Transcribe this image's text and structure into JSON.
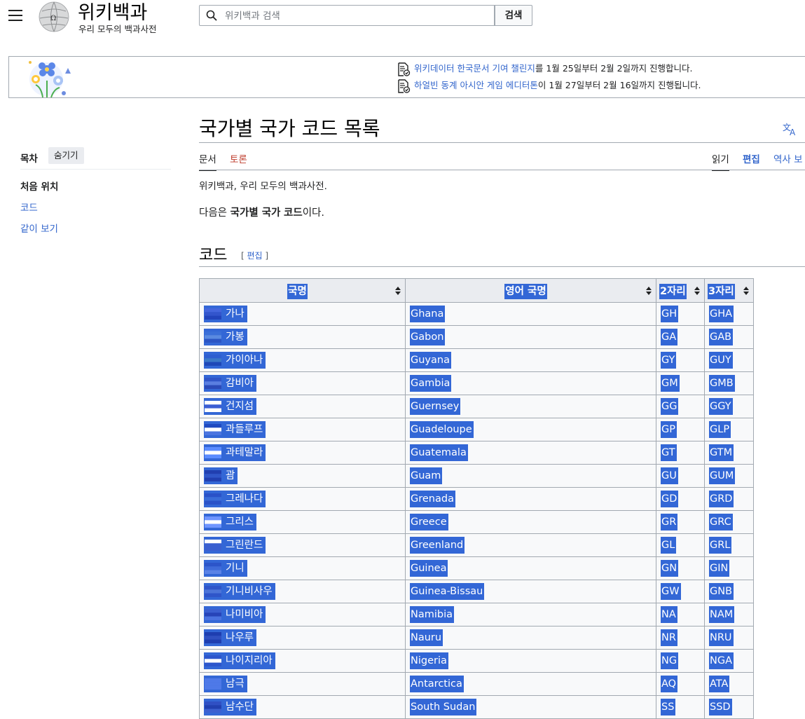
{
  "header": {
    "site_title": "위키백과",
    "site_tagline": "우리 모두의 백과사전",
    "search_placeholder": "위키백과 검색",
    "search_button": "검색"
  },
  "banner": {
    "notice_1": {
      "link": "위키데이터 한국문서 기여 챌린지",
      "text": "를 1월 25일부터 2월 2일까지 진행합니다."
    },
    "notice_2": {
      "link": "하얼빈 동계 아시안 게임 에디터톤",
      "text": "이 1월 27일부터 2월 16일까지 진행됩니다."
    }
  },
  "toc": {
    "title": "목차",
    "hide_label": "숨기기",
    "items": [
      "처음 위치",
      "코드",
      "같이 보기"
    ]
  },
  "page": {
    "title": "국가별 국가 코드 목록",
    "tabs": {
      "article": "문서",
      "talk": "토론",
      "read": "읽기",
      "edit": "편집",
      "history": "역사 보"
    },
    "site_sub": "위키백과, 우리 모두의 백과사전.",
    "intro_pre": "다음은 ",
    "intro_bold_1": "국가별 국가",
    "intro_bold_2": "코드",
    "intro_post": "이다.",
    "section_heading": "코드",
    "section_edit_open": "[ ",
    "section_edit_link": "편집",
    "section_edit_close": " ]"
  },
  "table": {
    "headers": [
      "국명",
      "영어 국명",
      "2자리",
      "3자리"
    ],
    "rows": [
      {
        "ko": "가나",
        "en": "Ghana",
        "a2": "GH",
        "a3": "GHA"
      },
      {
        "ko": "가봉",
        "en": "Gabon",
        "a2": "GA",
        "a3": "GAB"
      },
      {
        "ko": "가이아나",
        "en": "Guyana",
        "a2": "GY",
        "a3": "GUY"
      },
      {
        "ko": "감비아",
        "en": "Gambia",
        "a2": "GM",
        "a3": "GMB"
      },
      {
        "ko": "건지섬",
        "en": "Guernsey",
        "a2": "GG",
        "a3": "GGY"
      },
      {
        "ko": "과들루프",
        "en": "Guadeloupe",
        "a2": "GP",
        "a3": "GLP"
      },
      {
        "ko": "과테말라",
        "en": "Guatemala",
        "a2": "GT",
        "a3": "GTM"
      },
      {
        "ko": "괌",
        "en": "Guam",
        "a2": "GU",
        "a3": "GUM"
      },
      {
        "ko": "그레나다",
        "en": "Grenada",
        "a2": "GD",
        "a3": "GRD"
      },
      {
        "ko": "그리스",
        "en": "Greece",
        "a2": "GR",
        "a3": "GRC"
      },
      {
        "ko": "그린란드",
        "en": "Greenland",
        "a2": "GL",
        "a3": "GRL"
      },
      {
        "ko": "기니",
        "en": "Guinea",
        "a2": "GN",
        "a3": "GIN"
      },
      {
        "ko": "기니비사우",
        "en": "Guinea-Bissau",
        "a2": "GW",
        "a3": "GNB"
      },
      {
        "ko": "나미비아",
        "en": "Namibia",
        "a2": "NA",
        "a3": "NAM"
      },
      {
        "ko": "나우루",
        "en": "Nauru",
        "a2": "NR",
        "a3": "NRU"
      },
      {
        "ko": "나이지리아",
        "en": "Nigeria",
        "a2": "NG",
        "a3": "NGA"
      },
      {
        "ko": "남극",
        "en": "Antarctica",
        "a2": "AQ",
        "a3": "ATA"
      },
      {
        "ko": "남수단",
        "en": "South Sudan",
        "a2": "SS",
        "a3": "SSD"
      }
    ]
  },
  "colors": {
    "link": "#3366cc",
    "selection": "#3367d6",
    "talk_tab": "#bf3c2c"
  }
}
